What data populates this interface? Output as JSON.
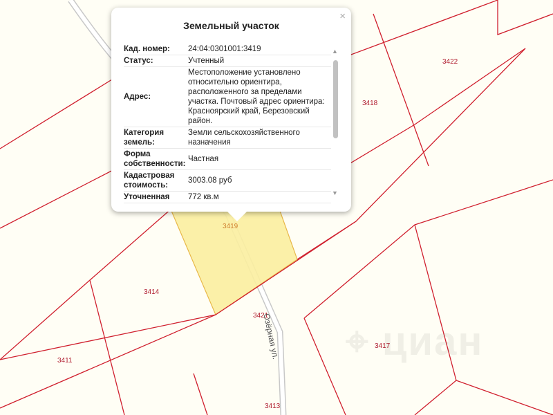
{
  "map": {
    "parcels": [
      "3422",
      "3418",
      "3419",
      "3414",
      "3421",
      "3411",
      "3417",
      "3413"
    ],
    "street": "Озёрная ул.",
    "watermark": "циан",
    "colors": {
      "boundary": "#d0202e",
      "highlight": "#fbeea0",
      "road": "#c8c8c8"
    }
  },
  "popup": {
    "title": "Земельный участок",
    "close": "×",
    "rows": [
      {
        "key": "Кад. номер:",
        "value": "24:04:0301001:3419"
      },
      {
        "key": "Статус:",
        "value": "Учтенный"
      },
      {
        "key": "Адрес:",
        "value": "Местоположение установлено относительно ориентира, расположенного за пределами участка. Почтовый адрес ориентира: Красноярский край, Березовский район."
      },
      {
        "key": "Категория земель:",
        "value": "Земли сельскохозяйственного назначения"
      },
      {
        "key": "Форма собственности:",
        "value": "Частная"
      },
      {
        "key": "Кадастровая стоимость:",
        "value": "3003.08 руб"
      },
      {
        "key": "Уточненная",
        "value": "772 кв.м"
      }
    ]
  }
}
